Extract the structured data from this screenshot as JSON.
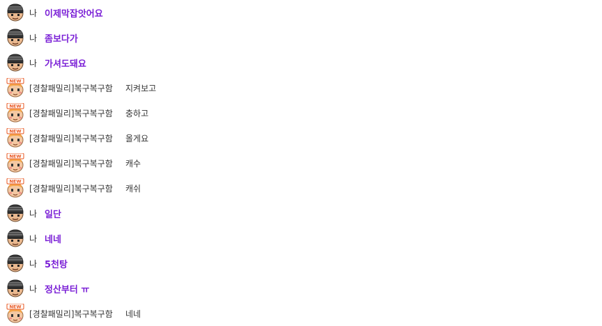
{
  "chat": {
    "messages": [
      {
        "kind": "me",
        "avatar": "helmet-avatar-icon",
        "sender": "나",
        "text": "이제막잡앗어요"
      },
      {
        "kind": "me",
        "avatar": "helmet-avatar-icon",
        "sender": "나",
        "text": "좀보다가"
      },
      {
        "kind": "me",
        "avatar": "helmet-avatar-icon",
        "sender": "나",
        "text": "가셔도돼요"
      },
      {
        "kind": "other",
        "avatar": "new-user-avatar-icon",
        "badge": "NEW",
        "sender": "[경찰패밀리]복구복구함",
        "text": "지켜보고"
      },
      {
        "kind": "other",
        "avatar": "new-user-avatar-icon",
        "badge": "NEW",
        "sender": "[경찰패밀리]복구복구함",
        "text": "충하고"
      },
      {
        "kind": "other",
        "avatar": "new-user-avatar-icon",
        "badge": "NEW",
        "sender": "[경찰패밀리]복구복구함",
        "text": "올게요"
      },
      {
        "kind": "other",
        "avatar": "new-user-avatar-icon",
        "badge": "NEW",
        "sender": "[경찰패밀리]복구복구함",
        "text": "캐수"
      },
      {
        "kind": "other",
        "avatar": "new-user-avatar-icon",
        "badge": "NEW",
        "sender": "[경찰패밀리]복구복구함",
        "text": "캐쉬"
      },
      {
        "kind": "me",
        "avatar": "helmet-avatar-icon",
        "sender": "나",
        "text": "일단"
      },
      {
        "kind": "me",
        "avatar": "helmet-avatar-icon",
        "sender": "나",
        "text": "네네"
      },
      {
        "kind": "me",
        "avatar": "helmet-avatar-icon",
        "sender": "나",
        "text": "5천탕"
      },
      {
        "kind": "me",
        "avatar": "helmet-avatar-icon",
        "sender": "나",
        "text": "정산부터 ㅠ"
      },
      {
        "kind": "other",
        "avatar": "new-user-avatar-icon",
        "badge": "NEW",
        "sender": "[경찰패밀리]복구복구함",
        "text": "네네"
      }
    ]
  },
  "colors": {
    "my_message": "#7a1fd6",
    "other_message": "#333333",
    "sender_text": "#333333",
    "new_badge": "#e8541e"
  }
}
